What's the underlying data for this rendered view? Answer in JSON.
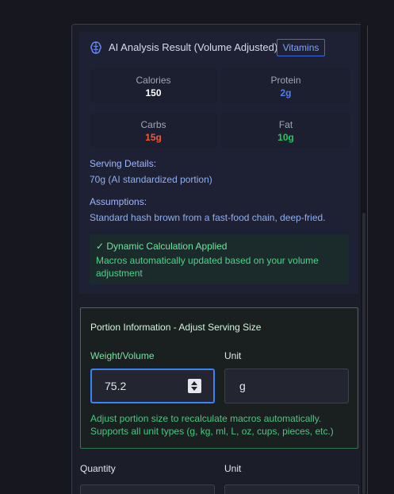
{
  "header": {
    "title": "AI Analysis Result (Volume Adjusted)",
    "badge": "Vitamins",
    "icon": "brain-icon"
  },
  "stats": [
    {
      "label": "Calories",
      "value": "150",
      "color": "#ffffff"
    },
    {
      "label": "Protein",
      "value": "2g",
      "color": "#4f7df5"
    },
    {
      "label": "Carbs",
      "value": "15g",
      "color": "#ef5a3c"
    },
    {
      "label": "Fat",
      "value": "10g",
      "color": "#22c55e"
    }
  ],
  "serving": {
    "label": "Serving Details:",
    "text": "70g (AI standardized portion)"
  },
  "assumptions": {
    "label": "Assumptions:",
    "text": "Standard hash brown from a fast-food chain, deep-fried."
  },
  "calculation": {
    "title": "✓ Dynamic Calculation Applied",
    "desc_line1": "Macros automatically updated based on your volume",
    "desc_line2": "adjustment"
  },
  "portion": {
    "title": "Portion Information - Adjust Serving Size",
    "weight_label": "Weight/Volume",
    "weight_value": "75.2",
    "unit_label": "Unit",
    "unit_value": "g",
    "help_line1": "Adjust portion size to recalculate macros automatically.",
    "help_line2": "Supports all unit types (g, kg, ml, L, oz, cups, pieces, etc.)"
  },
  "quantity": {
    "quantity_label": "Quantity",
    "unit_label": "Unit"
  }
}
